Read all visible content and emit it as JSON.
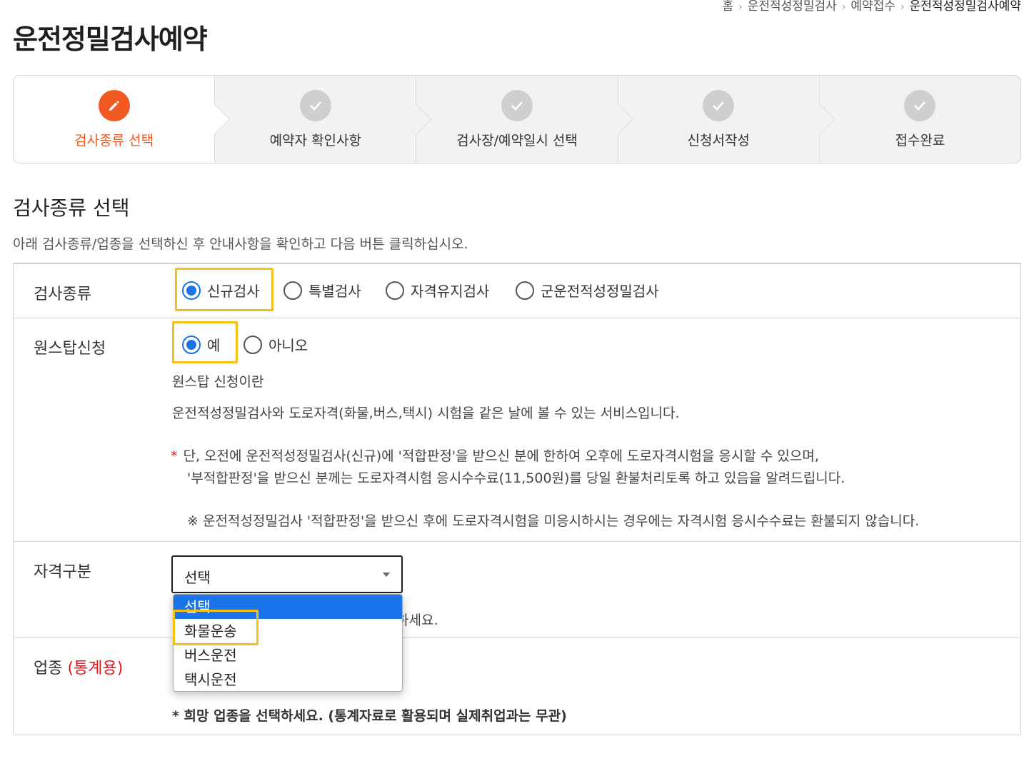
{
  "breadcrumb": {
    "home": "홈",
    "level1": "운전적성정밀검사",
    "level2": "예약접수",
    "current": "운전적성정밀검사예약"
  },
  "page_title": "운전정밀검사예약",
  "steps": [
    {
      "label": "검사종류 선택",
      "icon": "pencil-icon",
      "state": "active"
    },
    {
      "label": "예약자 확인사항",
      "icon": "check-icon",
      "state": "pending"
    },
    {
      "label": "검사장/예약일시 선택",
      "icon": "check-icon",
      "state": "pending"
    },
    {
      "label": "신청서작성",
      "icon": "check-icon",
      "state": "pending"
    },
    {
      "label": "접수완료",
      "icon": "check-icon",
      "state": "pending"
    }
  ],
  "section": {
    "title": "검사종류 선택",
    "description": "아래 검사종류/업종을 선택하신 후 안내사항을 확인하고 다음 버튼 클릭하십시오."
  },
  "form": {
    "exam_type": {
      "label": "검사종류",
      "options": [
        "신규검사",
        "특별검사",
        "자격유지검사",
        "군운전적성정밀검사"
      ],
      "selected": "신규검사"
    },
    "onestop": {
      "label": "원스탑신청",
      "options": [
        "예",
        "아니오"
      ],
      "selected": "예",
      "info_title": "원스탑 신청이란",
      "info_text": "운전적성정밀검사와 도로자격(화물,버스,택시) 시험을 같은 날에 볼 수 있는 서비스입니다.",
      "notice_star": "*",
      "notice_line1": "단, 오전에 운전적성정밀검사(신규)에 '적합판정'을 받으신 분에 한하여 오후에 도로자격시험을 응시할 수 있으며,",
      "notice_line2": "'부적합판정'을 받으신 분께는 도로자격시험 응시수수료(11,500원)를 당일 환불처리토록 하고 있음을 알려드립니다.",
      "notice_line3": "※ 운전적성정밀검사 '적합판정'을 받으신 후에 도로자격시험을 미응시하시는 경우에는 자격시험 응시수수료는 환불되지 않습니다."
    },
    "qualification": {
      "label": "자격구분",
      "select_value": "선택",
      "options": [
        "선택",
        "화물운송",
        "버스운전",
        "택시운전"
      ],
      "highlighted_option": "화물운송",
      "hint_tail": "하세요."
    },
    "industry": {
      "label": "업종",
      "label_suffix": "(통계용)",
      "hint": "* 희망 업종을 선택하세요. (통계자료로 활용되며 실제취업과는 무관)"
    }
  },
  "colors": {
    "accent": "#f05a22",
    "radio_checked": "#1a73e8",
    "highlight": "#f5c116",
    "required": "#e8141b"
  }
}
